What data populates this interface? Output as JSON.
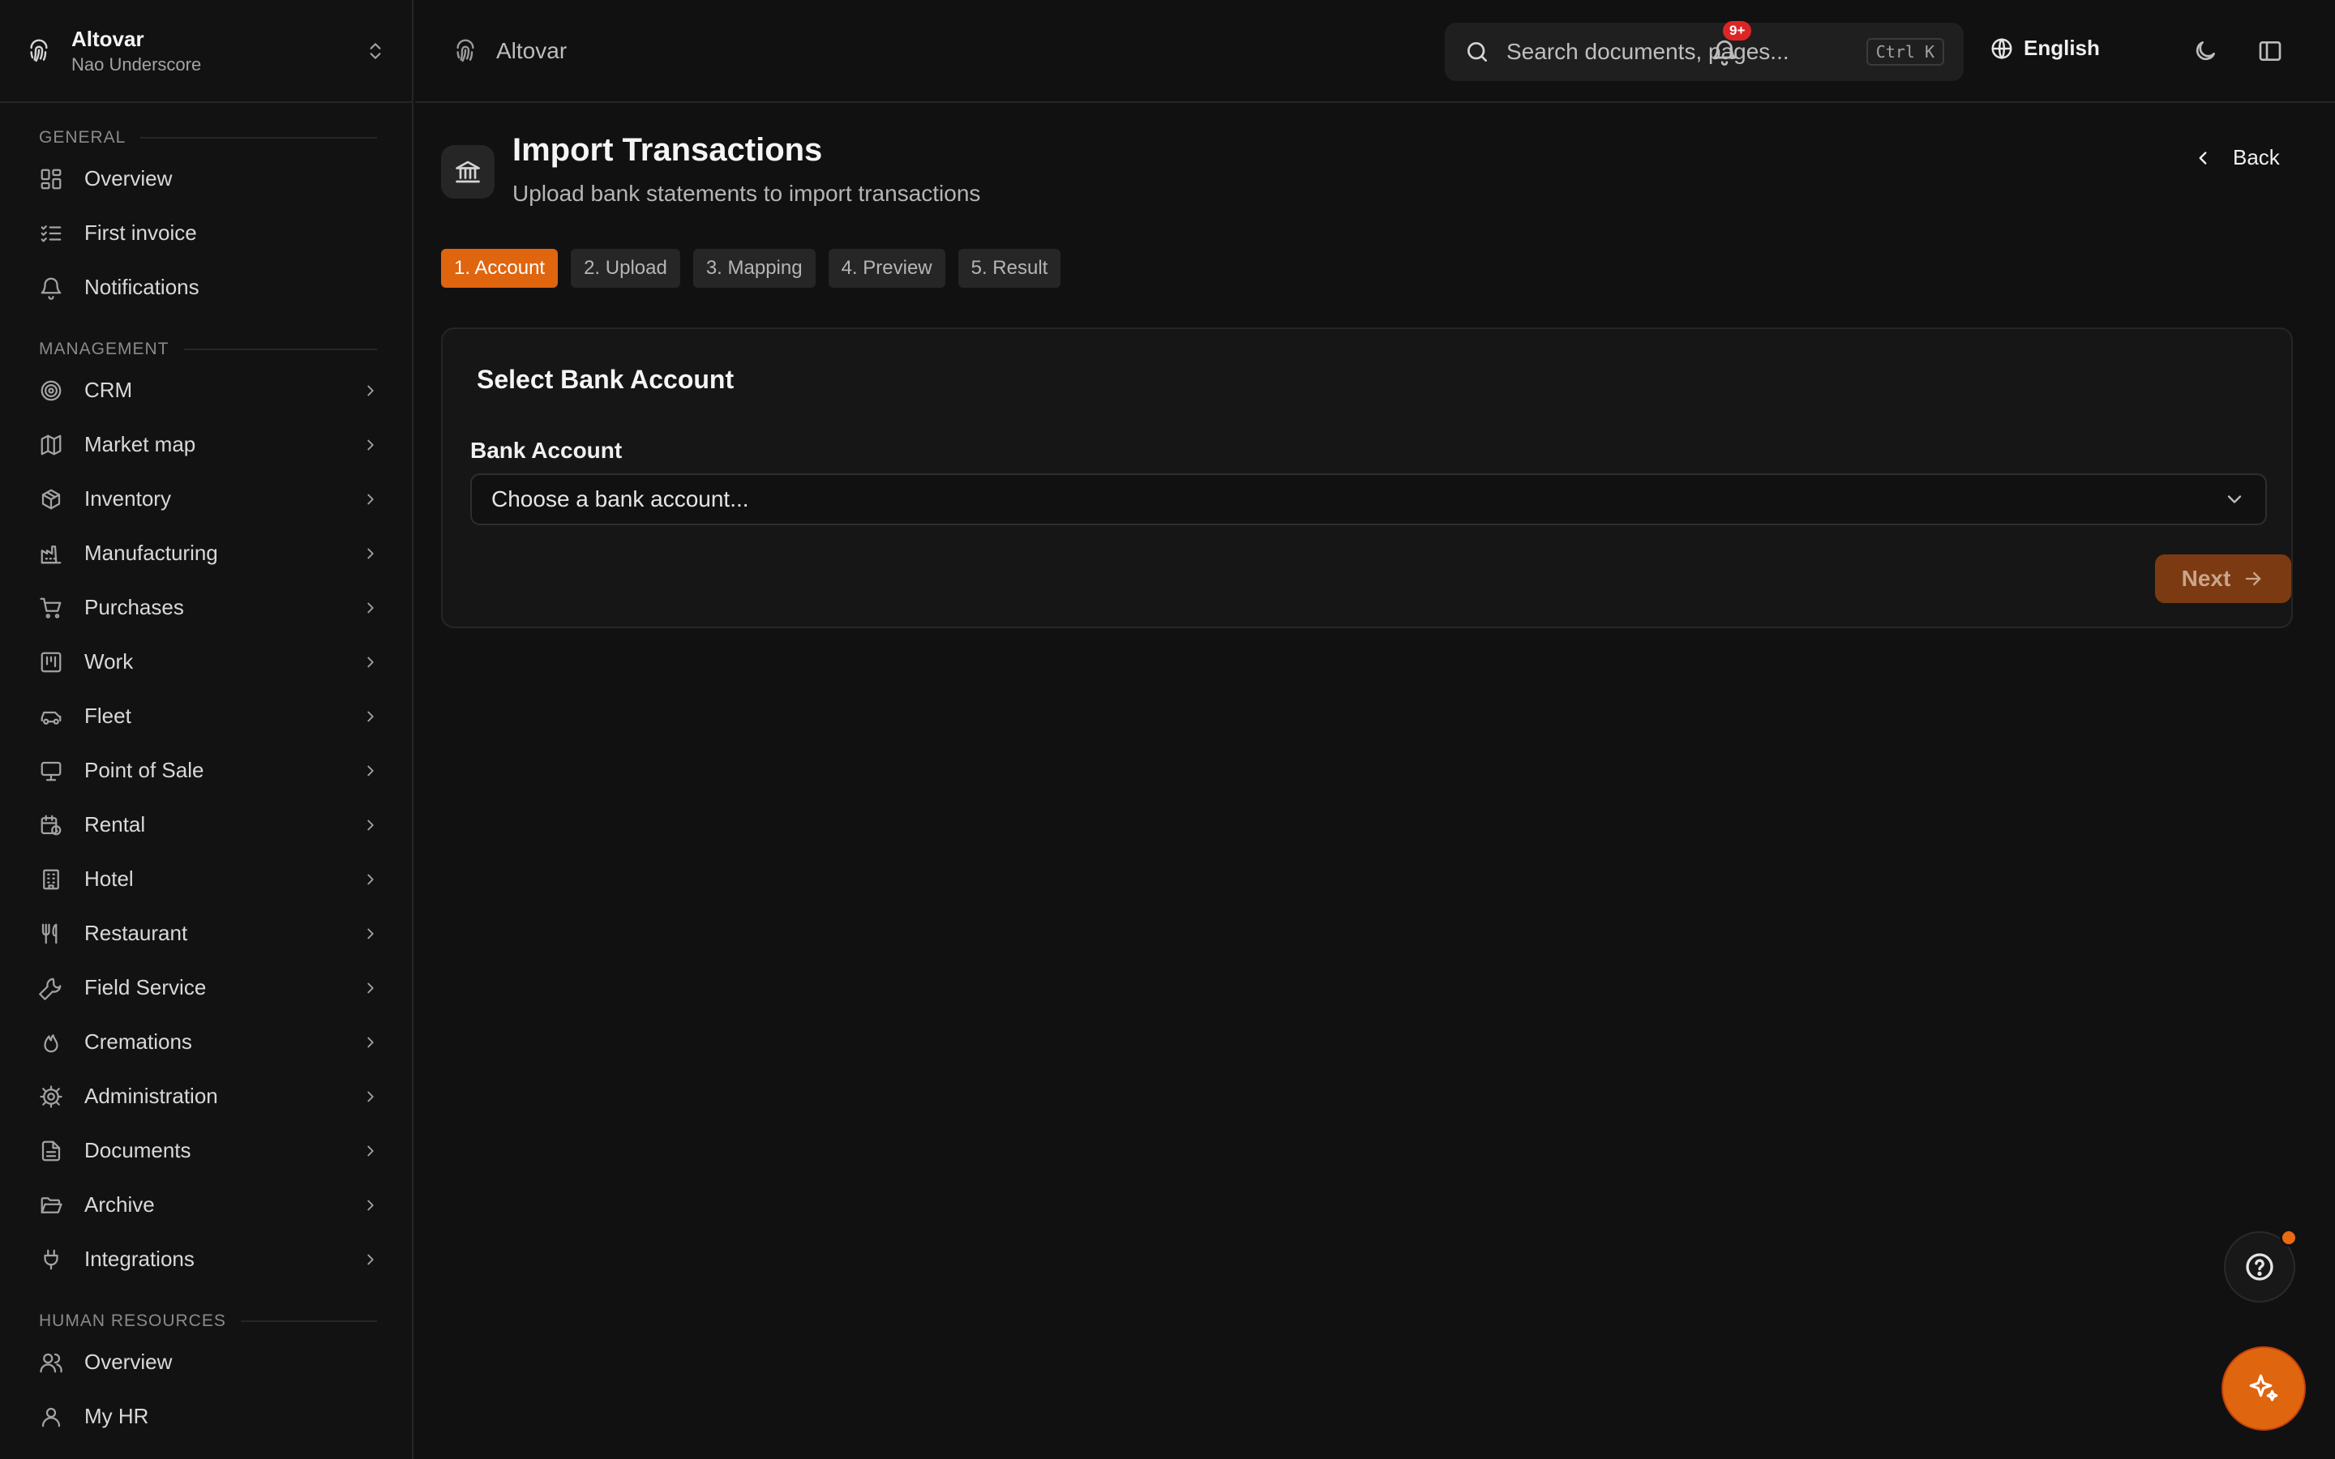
{
  "org": {
    "name": "Altovar",
    "subtitle": "Nao Underscore"
  },
  "sidebar": {
    "general_label": "GENERAL",
    "general": [
      {
        "label": "Overview",
        "icon": "dashboard-icon"
      },
      {
        "label": "First invoice",
        "icon": "checklist-icon"
      },
      {
        "label": "Notifications",
        "icon": "bell-icon"
      }
    ],
    "management_label": "MANAGEMENT",
    "management": [
      {
        "label": "CRM",
        "icon": "target-icon"
      },
      {
        "label": "Market map",
        "icon": "map-icon"
      },
      {
        "label": "Inventory",
        "icon": "package-icon"
      },
      {
        "label": "Manufacturing",
        "icon": "factory-icon"
      },
      {
        "label": "Purchases",
        "icon": "cart-icon"
      },
      {
        "label": "Work",
        "icon": "kanban-icon"
      },
      {
        "label": "Fleet",
        "icon": "car-icon"
      },
      {
        "label": "Point of Sale",
        "icon": "monitor-icon"
      },
      {
        "label": "Rental",
        "icon": "calendar-clock-icon"
      },
      {
        "label": "Hotel",
        "icon": "building-icon"
      },
      {
        "label": "Restaurant",
        "icon": "utensils-icon"
      },
      {
        "label": "Field Service",
        "icon": "wrench-icon"
      },
      {
        "label": "Cremations",
        "icon": "flame-icon"
      },
      {
        "label": "Administration",
        "icon": "gear-icon"
      },
      {
        "label": "Documents",
        "icon": "file-icon"
      },
      {
        "label": "Archive",
        "icon": "folder-open-icon"
      },
      {
        "label": "Integrations",
        "icon": "plug-icon"
      }
    ],
    "hr_label": "HUMAN RESOURCES",
    "hr": [
      {
        "label": "Overview",
        "icon": "users-icon"
      },
      {
        "label": "My HR",
        "icon": "user-icon"
      }
    ]
  },
  "topbar": {
    "breadcrumb": "Altovar",
    "search_placeholder": "Search documents, pages...",
    "search_shortcut": "Ctrl K",
    "language": "English",
    "notification_badge": "9+"
  },
  "page": {
    "title": "Import Transactions",
    "subtitle": "Upload bank statements to import transactions",
    "back_label": "Back",
    "steps": [
      "1. Account",
      "2. Upload",
      "3. Mapping",
      "4. Preview",
      "5. Result"
    ],
    "active_step": 0,
    "card_title": "Select Bank Account",
    "field_label": "Bank Account",
    "select_value": "Choose a bank account...",
    "next_label": "Next"
  },
  "colors": {
    "accent": "#e0650f",
    "background": "#111111",
    "badge": "#dc2626"
  }
}
